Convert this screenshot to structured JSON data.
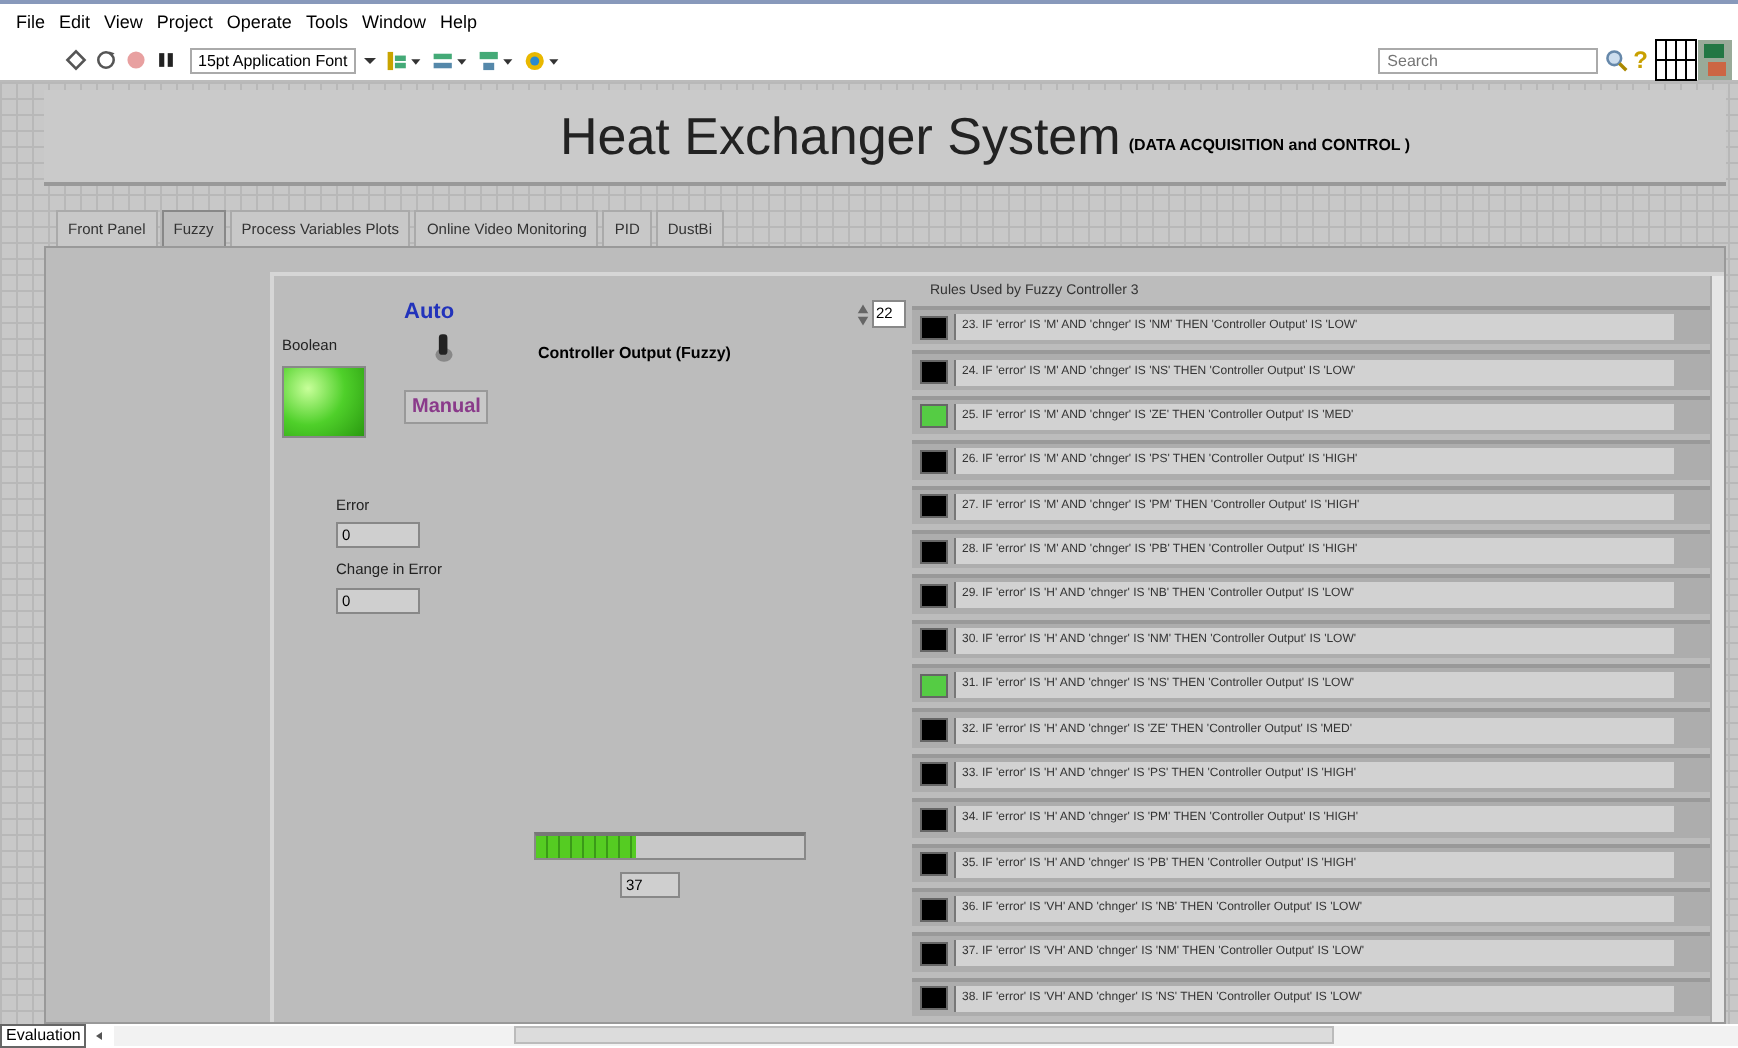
{
  "menu": [
    "File",
    "Edit",
    "View",
    "Project",
    "Operate",
    "Tools",
    "Window",
    "Help"
  ],
  "toolbar": {
    "font": "15pt Application Font",
    "search": {
      "placeholder": "Search"
    },
    "help": "?"
  },
  "title": "Heat Exchanger System",
  "subtitle": "(DATA ACQUISITION and CONTROL )",
  "tabs": [
    {
      "label": "Front Panel",
      "selected": false
    },
    {
      "label": "Fuzzy",
      "selected": true
    },
    {
      "label": "Process Variables Plots",
      "selected": false
    },
    {
      "label": "Online Video Monitoring",
      "selected": false
    },
    {
      "label": "PID",
      "selected": false
    },
    {
      "label": "DustBi",
      "selected": false
    }
  ],
  "boolean": {
    "label": "Boolean",
    "on": true
  },
  "mode_switch": {
    "auto_label": "Auto",
    "manual_label": "Manual",
    "auto": true
  },
  "error": {
    "label": "Error",
    "value": "0"
  },
  "change_in_error": {
    "label": "Change in Error",
    "value": "0"
  },
  "controller_output": {
    "label": "Controller Output  (Fuzzy)",
    "level": 0.37,
    "value": "37"
  },
  "rules": {
    "title": "Rules Used by Fuzzy Controller 3",
    "index": "22",
    "items": [
      {
        "text": "23. IF 'error' IS 'M' AND 'chnger' IS 'NM' THEN 'Controller Output' IS 'LOW'",
        "on": false
      },
      {
        "text": "24. IF 'error' IS 'M' AND 'chnger' IS 'NS' THEN 'Controller Output' IS 'LOW'",
        "on": false
      },
      {
        "text": "25. IF 'error' IS 'M' AND 'chnger' IS 'ZE' THEN 'Controller Output' IS 'MED'",
        "on": true
      },
      {
        "text": "26. IF 'error' IS 'M' AND 'chnger' IS 'PS' THEN 'Controller Output' IS 'HIGH'",
        "on": false
      },
      {
        "text": "27. IF 'error' IS 'M' AND 'chnger' IS 'PM' THEN 'Controller Output' IS 'HIGH'",
        "on": false
      },
      {
        "text": "28. IF 'error' IS 'M' AND 'chnger' IS 'PB' THEN 'Controller Output' IS 'HIGH'",
        "on": false
      },
      {
        "text": "29. IF 'error' IS 'H' AND 'chnger' IS 'NB' THEN 'Controller Output' IS 'LOW'",
        "on": false
      },
      {
        "text": "30. IF 'error' IS 'H' AND 'chnger' IS 'NM' THEN 'Controller Output' IS 'LOW'",
        "on": false
      },
      {
        "text": "31. IF 'error' IS 'H' AND 'chnger' IS 'NS' THEN 'Controller Output' IS 'LOW'",
        "on": true
      },
      {
        "text": "32. IF 'error' IS 'H' AND 'chnger' IS 'ZE' THEN 'Controller Output' IS 'MED'",
        "on": false
      },
      {
        "text": "33. IF 'error' IS 'H' AND 'chnger' IS 'PS' THEN 'Controller Output' IS 'HIGH'",
        "on": false
      },
      {
        "text": "34. IF 'error' IS 'H' AND 'chnger' IS 'PM' THEN 'Controller Output' IS 'HIGH'",
        "on": false
      },
      {
        "text": "35. IF 'error' IS 'H' AND 'chnger' IS 'PB' THEN 'Controller Output' IS 'HIGH'",
        "on": false
      },
      {
        "text": "36. IF 'error' IS 'VH' AND 'chnger' IS 'NB' THEN 'Controller Output' IS 'LOW'",
        "on": false
      },
      {
        "text": "37. IF 'error' IS 'VH' AND 'chnger' IS 'NM' THEN 'Controller Output' IS 'LOW'",
        "on": false
      },
      {
        "text": "38. IF 'error' IS 'VH' AND 'chnger' IS 'NS' THEN 'Controller Output' IS 'LOW'",
        "on": false
      }
    ]
  },
  "status_bar": {
    "label": "Evaluation"
  }
}
